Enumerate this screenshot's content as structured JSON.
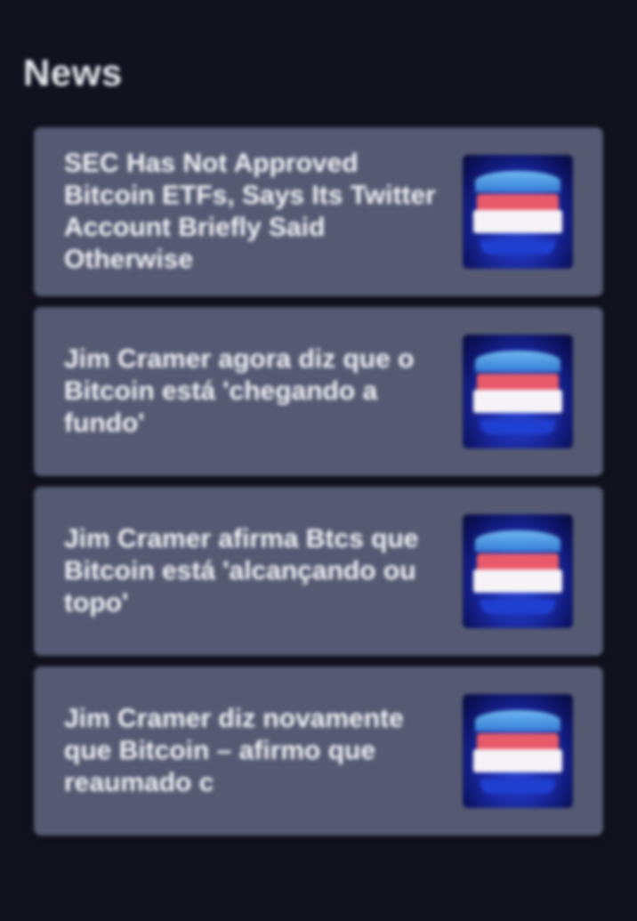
{
  "section": {
    "title": "News"
  },
  "news": [
    {
      "headline": "SEC Has Not Approved Bitcoin ETFs, Says Its Twitter Account Briefly Said Otherwise",
      "thumbnail_icon": "news-thumbnail-image"
    },
    {
      "headline": "Jim Cramer agora diz que o Bitcoin está 'chegando a fundo'",
      "thumbnail_icon": "news-thumbnail-image"
    },
    {
      "headline": "Jim Cramer afirma Btcs que Bitcoin está 'alcançando ou topo'",
      "thumbnail_icon": "news-thumbnail-image"
    },
    {
      "headline": "Jim Cramer diz novamente que Bitcoin – afirmo que reaumado c",
      "thumbnail_icon": "news-thumbnail-image"
    }
  ],
  "colors": {
    "background": "#12121f",
    "card": "#555a72",
    "text": "#f4f4f8"
  }
}
